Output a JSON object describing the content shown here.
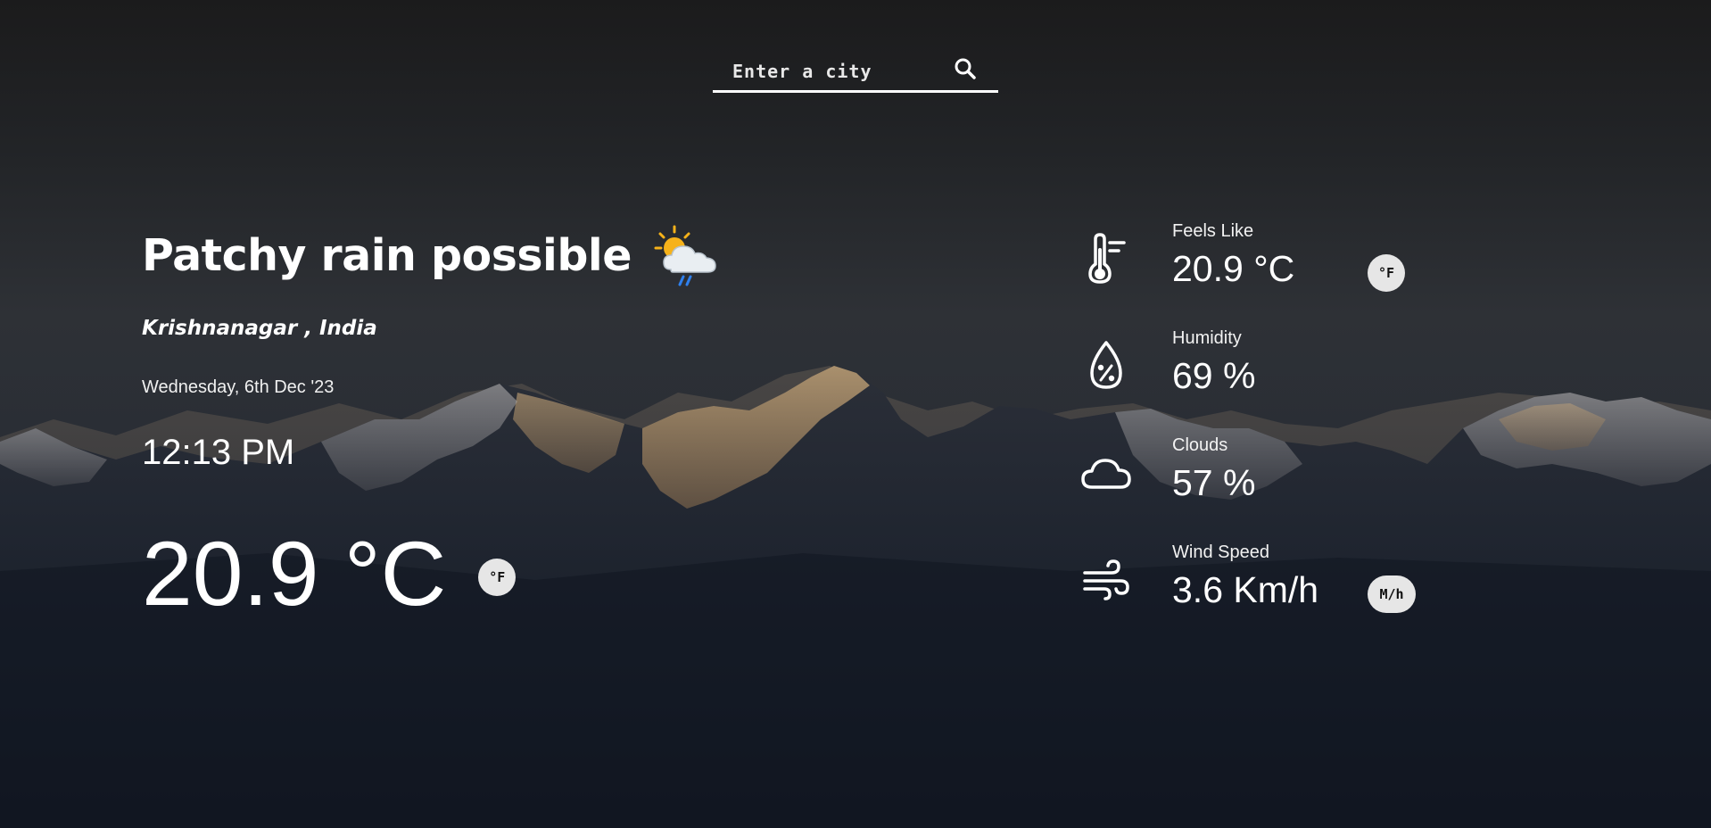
{
  "colors": {
    "text": "#ffffff",
    "unit_button_bg": "#e6e6e6",
    "unit_button_text": "#111111",
    "rain_accent": "#2f80ed",
    "sun": "#f6b21a"
  },
  "search": {
    "placeholder": "Enter a city",
    "value": "",
    "icon": "search-icon"
  },
  "weather": {
    "condition": "Patchy rain possible",
    "condition_icon": "sun-cloud-rain-icon",
    "location": "Krishnanagar , India",
    "date": "Wednesday, 6th Dec '23",
    "time": "12:13 PM",
    "temperature": "20.9 °C",
    "unit_toggle": "°F"
  },
  "stats": {
    "feels_like": {
      "label": "Feels Like",
      "value": "20.9 °C",
      "icon": "thermometer-icon",
      "unit_toggle": "°F"
    },
    "humidity": {
      "label": "Humidity",
      "value": "69 %",
      "icon": "humidity-drop-icon"
    },
    "clouds": {
      "label": "Clouds",
      "value": "57 %",
      "icon": "cloud-icon"
    },
    "wind_speed": {
      "label": "Wind Speed",
      "value": "3.6 Km/h",
      "icon": "wind-icon",
      "unit_toggle": "M/h"
    }
  }
}
